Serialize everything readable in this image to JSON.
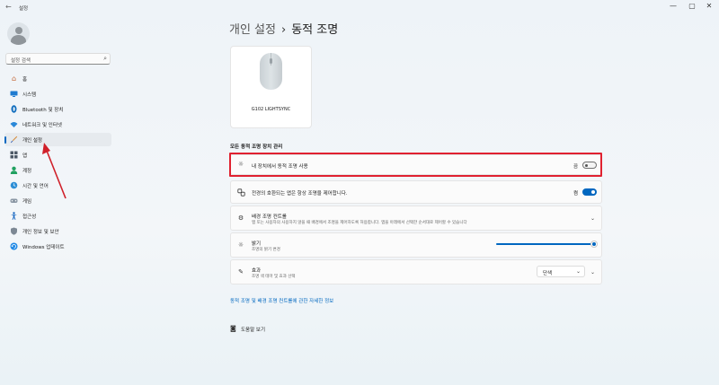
{
  "window": {
    "title": "설정",
    "back_icon": "back-arrow-icon",
    "minimize_glyph": "—",
    "maximize_glyph": "▢",
    "close_glyph": "✕"
  },
  "sidebar": {
    "search_placeholder": "설정 검색",
    "items": [
      {
        "id": "home",
        "label": "홈",
        "icon": "home-icon"
      },
      {
        "id": "system",
        "label": "시스템",
        "icon": "monitor-icon"
      },
      {
        "id": "bluetooth",
        "label": "Bluetooth 및 장치",
        "icon": "bluetooth-icon"
      },
      {
        "id": "network",
        "label": "네트워크 및 인터넷",
        "icon": "wifi-icon"
      },
      {
        "id": "personalization",
        "label": "개인 설정",
        "icon": "brush-icon",
        "selected": true
      },
      {
        "id": "apps",
        "label": "앱",
        "icon": "apps-icon"
      },
      {
        "id": "accounts",
        "label": "계정",
        "icon": "person-icon"
      },
      {
        "id": "time",
        "label": "시간 및 언어",
        "icon": "globe-clock-icon"
      },
      {
        "id": "gaming",
        "label": "게임",
        "icon": "gamepad-icon"
      },
      {
        "id": "accessibility",
        "label": "접근성",
        "icon": "accessibility-icon"
      },
      {
        "id": "privacy",
        "label": "개인 정보 및 보안",
        "icon": "shield-icon"
      },
      {
        "id": "update",
        "label": "Windows 업데이트",
        "icon": "update-icon"
      }
    ]
  },
  "main": {
    "breadcrumb_parent": "개인 설정",
    "breadcrumb_separator": "›",
    "breadcrumb_current": "동적 조명",
    "device_name": "G102 LIGHTSYNC",
    "section_title": "모든 동적 조명 장치 관리",
    "use_dynamic_lighting": {
      "label": "내 장치에서 동적 조명 사용",
      "state": "끔",
      "on": false
    },
    "compatible_apps": {
      "label": "전경의 호환되는 앱은 항상 조명을 제어합니다.",
      "state": "켬",
      "on": true
    },
    "background_controls": {
      "label": "배경 조명 컨트롤",
      "description": "앱 또는 사용자의 사용하지 않을 때 배경에서 조명을 제어하도록 허용합니다. 앱을 아래에서 선택한 순서대로 제어할 수 있습니다"
    },
    "brightness": {
      "label": "밝기",
      "description": "조명의 밝기 변경",
      "value_percent": 100
    },
    "effects": {
      "label": "효과",
      "description": "조명 색 테마 및 효과 선택",
      "value": "단색"
    },
    "more_info_link": "동적 조명 및 배경 조명 컨트롤에 관한 자세한 정보",
    "help_link": "도움말 보기"
  },
  "colors": {
    "accent": "#0067c0",
    "highlight_box": "#e02130",
    "annotation_arrow": "#d0202a"
  }
}
